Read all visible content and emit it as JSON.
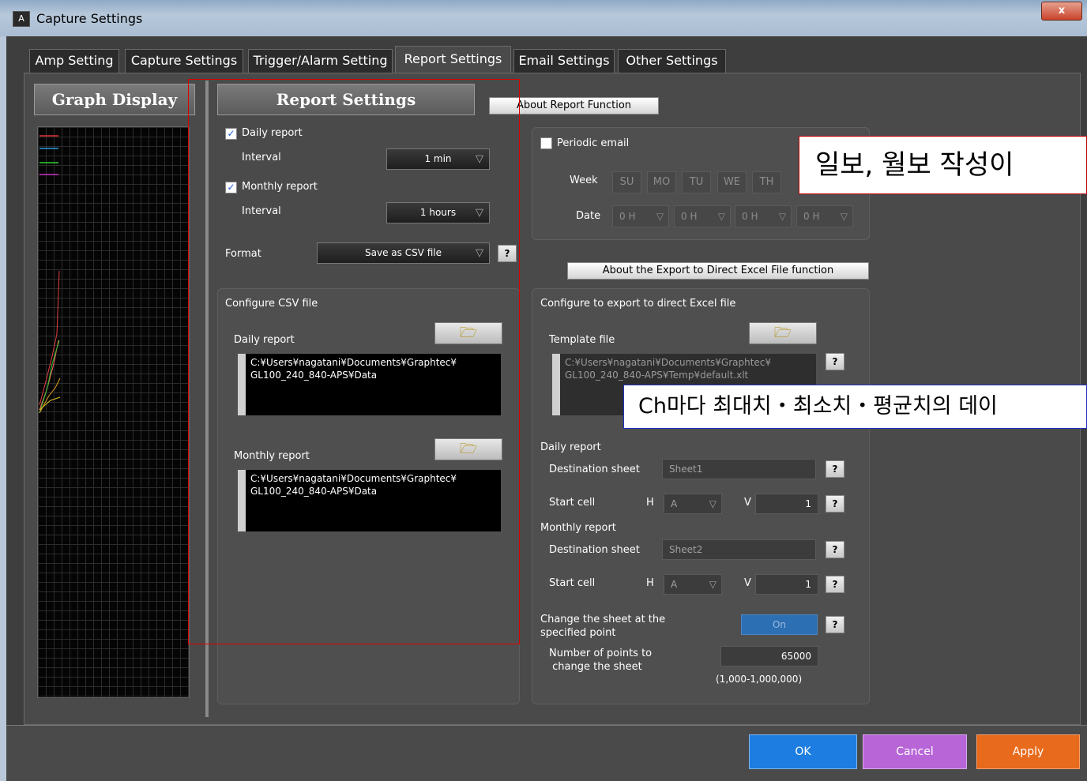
{
  "window": {
    "title": "Capture Settings",
    "close": "x"
  },
  "tabs": [
    "Amp Setting",
    "Capture Settings",
    "Trigger/Alarm Setting",
    "Report Settings",
    "Email Settings",
    "Other Settings"
  ],
  "graph": {
    "header": "Graph Display"
  },
  "report": {
    "header": "Report Settings",
    "daily_report": "Daily report",
    "monthly_report": "Monthly report",
    "interval": "Interval",
    "daily_interval": "1 min",
    "monthly_interval": "1 hours",
    "format": "Format",
    "format_value": "Save as CSV file",
    "about_button": "About Report Function",
    "csv_title": "Configure CSV file",
    "daily_path": "C:¥Users¥nagatani¥Documents¥Graphtec¥\nGL100_240_840-APS¥Data",
    "monthly_path": "C:¥Users¥nagatani¥Documents¥Graphtec¥\nGL100_240_840-APS¥Data"
  },
  "email": {
    "periodic": "Periodic email",
    "week": "Week",
    "date": "Date",
    "days": [
      "SU",
      "MO",
      "TU",
      "WE",
      "TH"
    ],
    "hours": [
      "0 H",
      "0 H",
      "0 H",
      "0 H"
    ]
  },
  "excel": {
    "about_button": "About the Export to Direct Excel File function",
    "title": "Configure to export to direct Excel file",
    "template": "Template file",
    "template_path": "C:¥Users¥nagatani¥Documents¥Graphtec¥\nGL100_240_840-APS¥Temp¥default.xlt",
    "daily_report": "Daily report",
    "monthly_report": "Monthly report",
    "destination": "Destination sheet",
    "start_cell": "Start cell",
    "sheet1": "Sheet1",
    "sheet2": "Sheet2",
    "h": "H",
    "v": "V",
    "col": "A",
    "row": "1",
    "change_sheet": "Change the sheet at the\nspecified point",
    "on": "On",
    "points_label": "Number of points to\n change the sheet",
    "points": "65000",
    "range": "(1,000-1,000,000)"
  },
  "annotations": {
    "a1": "일보, 월보 작성이",
    "a2": "Ch마다 최대치・최소치・평균치의 데이"
  },
  "buttons": {
    "ok": "OK",
    "cancel": "Cancel",
    "apply": "Apply"
  },
  "help": "?"
}
